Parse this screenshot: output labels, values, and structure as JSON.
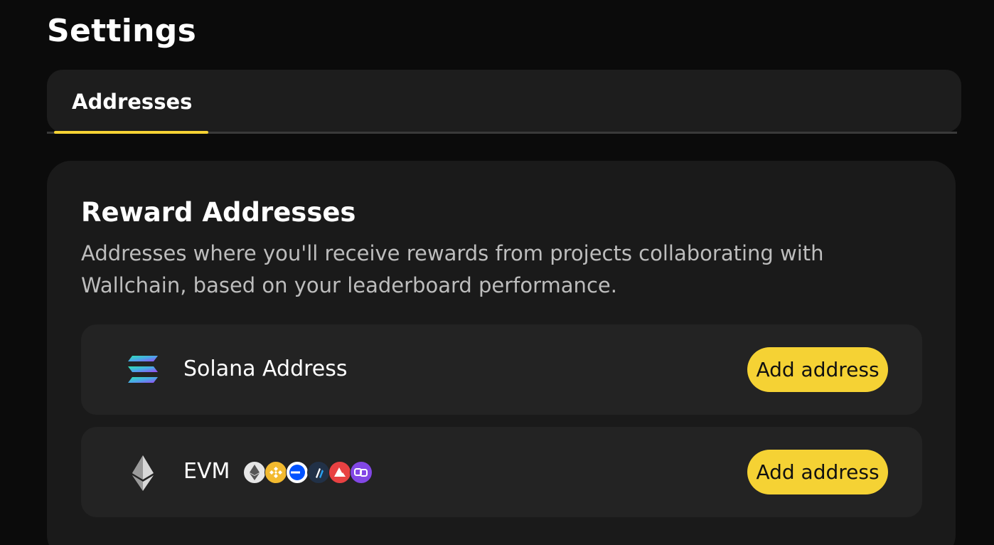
{
  "page": {
    "title": "Settings"
  },
  "tabs": [
    {
      "label": "Addresses",
      "active": true
    }
  ],
  "reward_addresses": {
    "title": "Reward Addresses",
    "description": "Addresses where you'll receive rewards from projects collaborating with Wallchain, based on your leaderboard performance.",
    "rows": [
      {
        "label": "Solana Address",
        "icon": "solana-icon",
        "button_label": "Add address"
      },
      {
        "label": "EVM",
        "icon": "ethereum-icon",
        "chains": [
          "ethereum-icon",
          "bnb-chain-icon",
          "base-icon",
          "arbitrum-icon",
          "avalanche-icon",
          "polygon-icon"
        ],
        "button_label": "Add address"
      }
    ]
  },
  "colors": {
    "background": "#0b0b0b",
    "card": "#1a1a1a",
    "row": "#232323",
    "accent": "#f5d234",
    "muted_text": "#bdbdbd"
  }
}
